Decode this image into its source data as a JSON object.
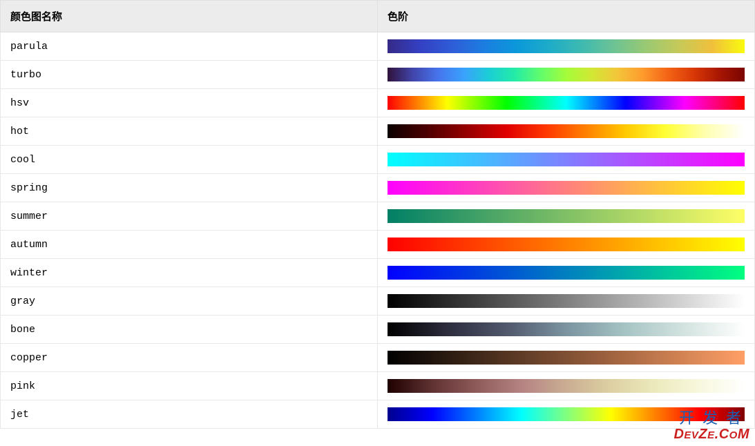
{
  "header": {
    "col1": "颜色图名称",
    "col2": "色阶"
  },
  "rows": [
    {
      "name": "parula",
      "gradient": "linear-gradient(to right, #352a87, #3440c3, #2f5dd8, #1b7ee0, #0b99da, #1eacc8, #3fbab0, #6ec393, #9bc972, #c7c958, #f0c03c, #f9fb0e)"
    },
    {
      "name": "turbo",
      "gradient": "linear-gradient(to right, #30123b, #4145ab, #4675ed, #39a2fc, #1bcfd4, #24eca6, #61fc6c, #a4fc3b, #d1e834, #f3c63a, #fe9b2d, #f36315, #d93806, #a81602, #7a0403)"
    },
    {
      "name": "hsv",
      "gradient": "linear-gradient(to right, #ff0000, #ffff00, #00ff00, #00ffff, #0000ff, #ff00ff, #ff0000)"
    },
    {
      "name": "hot",
      "gradient": "linear-gradient(to right, #0b0000, #4d0000, #960000, #e00000, #ff3700, #ff8000, #ffc900, #ffff36, #ffffaf, #ffffff)"
    },
    {
      "name": "cool",
      "gradient": "linear-gradient(to right, #00ffff, #ff00ff)"
    },
    {
      "name": "spring",
      "gradient": "linear-gradient(to right, #ff00ff, #ffff00)"
    },
    {
      "name": "summer",
      "gradient": "linear-gradient(to right, #008066, #ffff66)"
    },
    {
      "name": "autumn",
      "gradient": "linear-gradient(to right, #ff0000, #ffff00)"
    },
    {
      "name": "winter",
      "gradient": "linear-gradient(to right, #0000ff, #00ff80)"
    },
    {
      "name": "gray",
      "gradient": "linear-gradient(to right, #000000, #ffffff)"
    },
    {
      "name": "bone",
      "gradient": "linear-gradient(to right, #000000, #2c2c3c, #51586c, #7b94a0, #a6c4c4, #d4e4e0, #ffffff)"
    },
    {
      "name": "copper",
      "gradient": "linear-gradient(to right, #000000, #3f2819, #7f4f33, #bf774c, #ff9f66)"
    },
    {
      "name": "pink",
      "gradient": "linear-gradient(to right, #1e0000, #603232, #8f5a5a, #b58383, #caad93, #ddd0a2, #eceabd, #f8f8de, #ffffff)"
    },
    {
      "name": "jet",
      "gradient": "linear-gradient(to right, #00008f, #0000ff, #0080ff, #00ffff, #80ff80, #ffff00, #ff8000, #ff0000, #800000)"
    }
  ],
  "watermark": {
    "line1": "开发者",
    "line2_a": "D",
    "line2_b": "EV",
    "line2_c": "Z",
    "line2_d": "E",
    "line2_e": ".C",
    "line2_f": "O",
    "line2_g": "M"
  }
}
